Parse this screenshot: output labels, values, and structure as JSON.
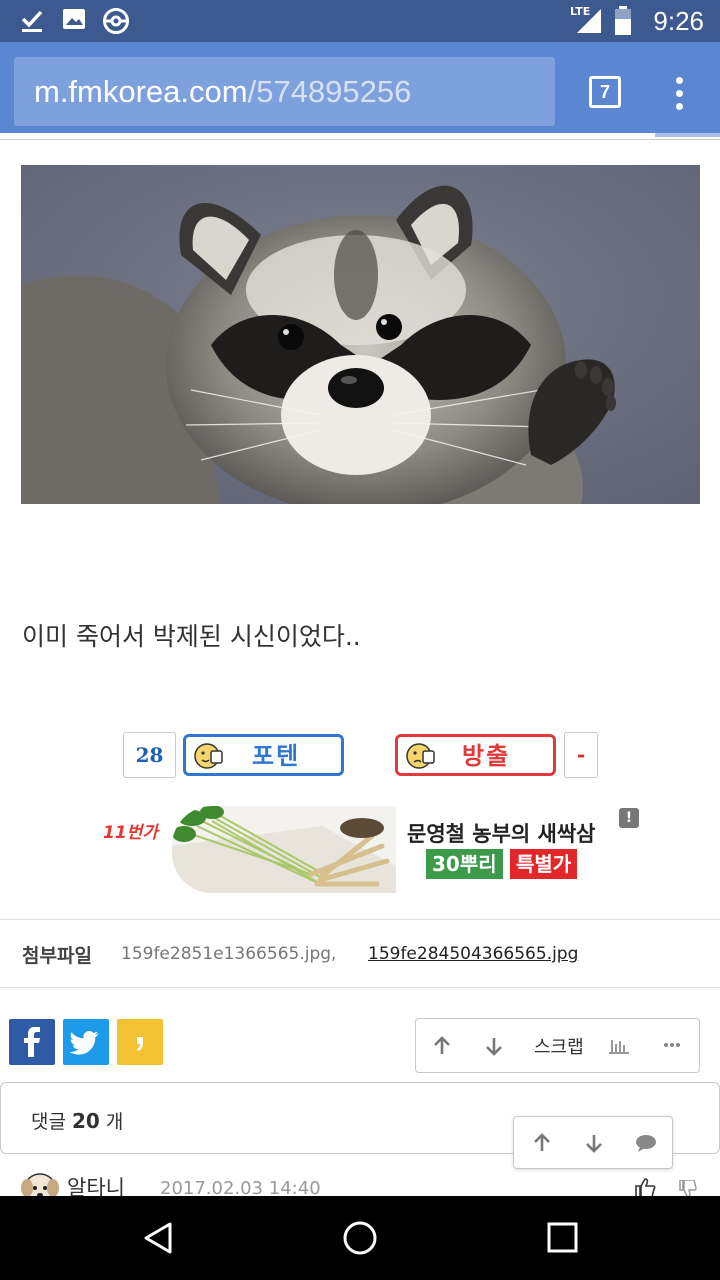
{
  "status_bar": {
    "time": "9:26",
    "network": "LTE",
    "left_icons": [
      "checkmark-download-icon",
      "image-icon",
      "pokeball-icon"
    ]
  },
  "browser": {
    "url_domain": "m.fmkorea.com",
    "url_path": "/574895256",
    "tab_count": "7",
    "page_load_progress": 0.91
  },
  "post": {
    "caption": "이미 죽어서 박제된 시신이었다..",
    "upvote_count": "28",
    "upvote_label": "포텐",
    "downvote_label": "방출",
    "downvote_count": "-"
  },
  "ad": {
    "brand": "11번가",
    "title": "문영철 농부의 새싹삼",
    "tag1": "30뿌리",
    "tag2": "특별가",
    "info": "!"
  },
  "attachments": {
    "label": "첨부파일",
    "files": [
      "159fe2851e1366565.jpg,",
      "159fe284504366565.jpg"
    ]
  },
  "actions": {
    "scrap_label": "스크랩"
  },
  "comments": {
    "label_prefix": "댓글",
    "count": "20",
    "label_suffix": "개",
    "first": {
      "author": "알타니",
      "date": "2017.02.03 14:40"
    }
  },
  "colors": {
    "status_bar": "#3c5a8f",
    "browser_bar": "#5b86d1",
    "upvote": "#2f77d0",
    "downvote": "#e03b3b"
  }
}
